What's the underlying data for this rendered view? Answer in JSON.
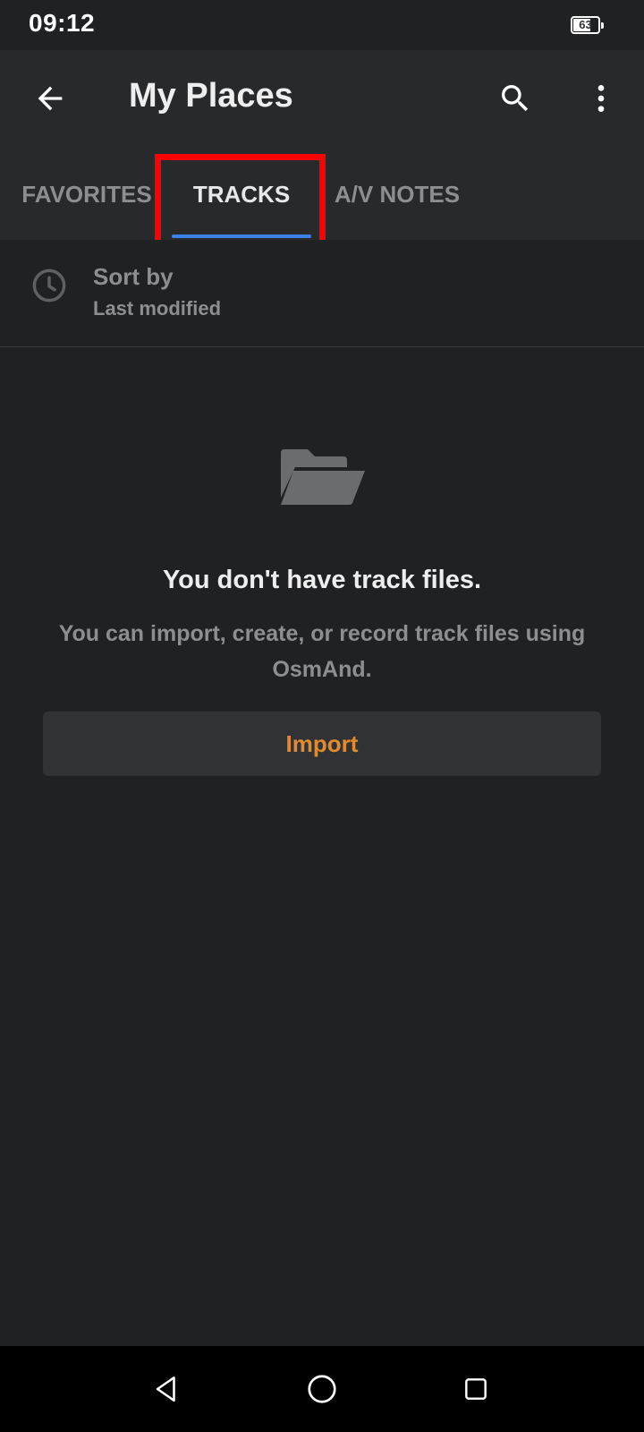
{
  "status_bar": {
    "time": "09:12",
    "battery_level": "63"
  },
  "app_bar": {
    "title": "My Places",
    "icons": {
      "back": "arrow-back-icon",
      "search": "search-icon",
      "more": "more-vert-icon"
    }
  },
  "tabs": [
    {
      "label": "FAVORITES",
      "selected": false
    },
    {
      "label": "TRACKS",
      "selected": true
    },
    {
      "label": "A/V NOTES",
      "selected": false
    }
  ],
  "sort": {
    "title": "Sort by",
    "value": "Last modified",
    "icon": "clock-icon"
  },
  "empty_state": {
    "icon": "folder-open-icon",
    "title": "You don't have track files.",
    "description": "You can import, create, or record track files using OsmAnd.",
    "button_label": "Import"
  },
  "colors": {
    "accent": "#e28b2d",
    "tab_indicator": "#3b82e6",
    "highlight": "#ff0000"
  },
  "nav_bar": {
    "icons": [
      "nav-back-icon",
      "nav-home-icon",
      "nav-recents-icon"
    ]
  }
}
